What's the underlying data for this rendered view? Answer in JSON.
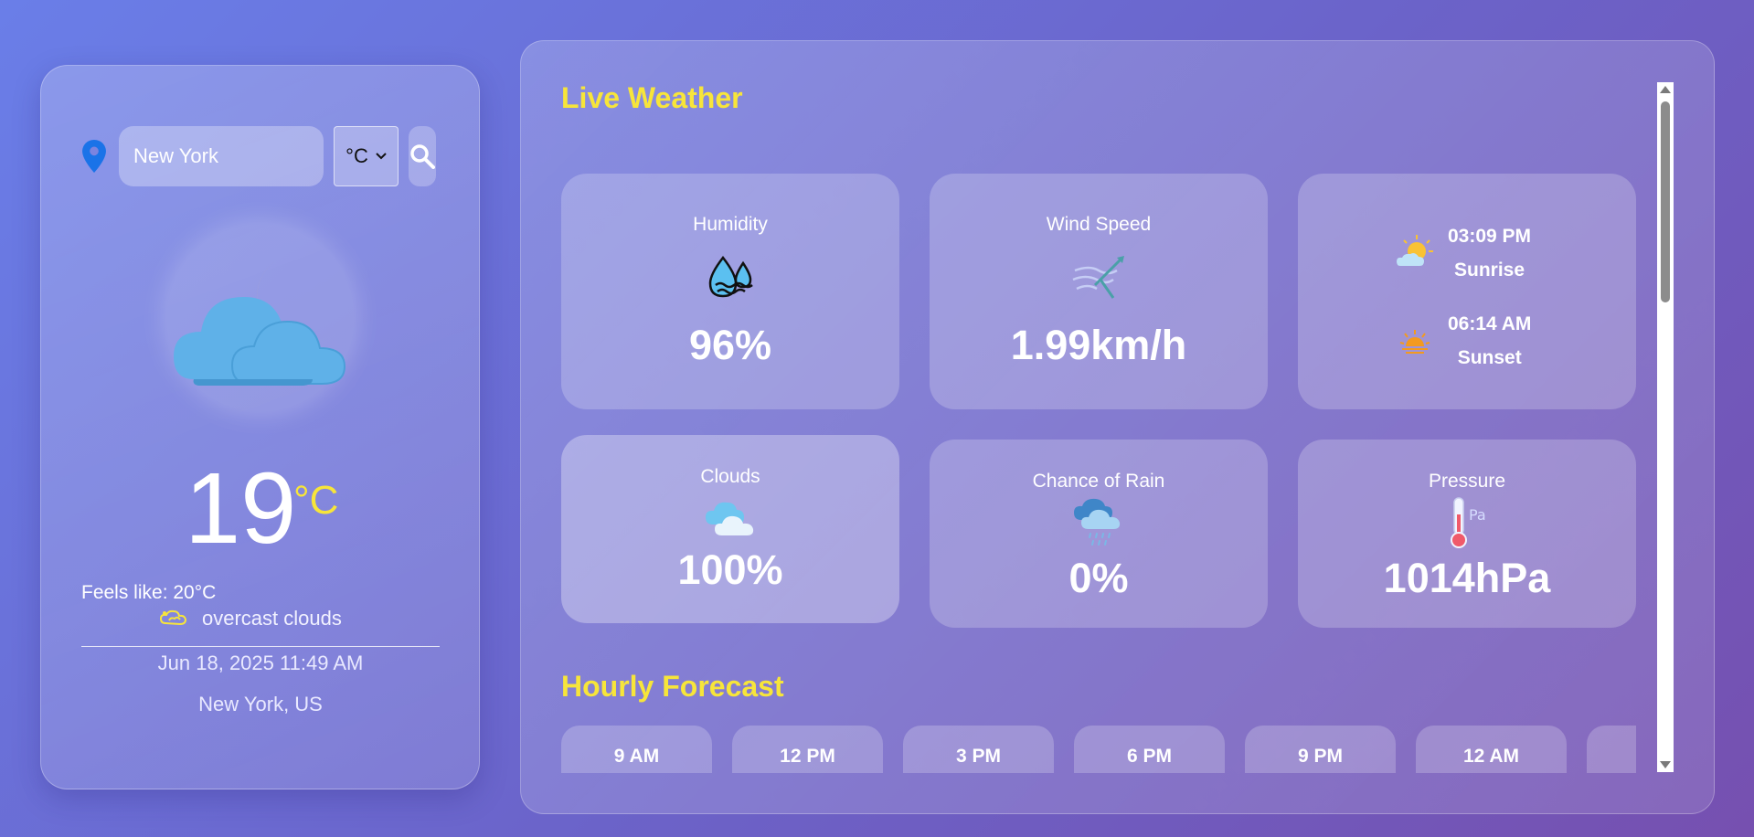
{
  "search": {
    "city_value": "New York",
    "unit_selected": "°C",
    "pin_icon": "map-pin-icon",
    "search_icon": "search-icon"
  },
  "current": {
    "icon": "moon-cloud-icon",
    "temperature": "19",
    "unit": "°C",
    "feels_like": "Feels like: 20°C",
    "description": "overcast clouds",
    "datetime": "Jun 18, 2025 11:49 AM",
    "location": "New York, US"
  },
  "live": {
    "title": "Live Weather",
    "humidity": {
      "label": "Humidity",
      "value": "96%",
      "icon": "humidity-drops-icon"
    },
    "wind": {
      "label": "Wind Speed",
      "value": "1.99km/h",
      "icon": "wind-icon"
    },
    "sun": {
      "sunrise_time": "03:09 PM",
      "sunrise_label": "Sunrise",
      "sunrise_icon": "sunrise-icon",
      "sunset_time": "06:14 AM",
      "sunset_label": "Sunset",
      "sunset_icon": "sunset-icon"
    },
    "clouds": {
      "label": "Clouds",
      "value": "100%",
      "icon": "clouds-icon"
    },
    "rain": {
      "label": "Chance of Rain",
      "value": "0%",
      "icon": "rain-cloud-icon"
    },
    "pressure": {
      "label": "Pressure",
      "value": "1014hPa",
      "icon": "thermometer-pa-icon"
    }
  },
  "hourly": {
    "title": "Hourly Forecast",
    "hours": [
      "9 AM",
      "12 PM",
      "3 PM",
      "6 PM",
      "9 PM",
      "12 AM",
      ""
    ]
  },
  "colors": {
    "accent_yellow": "#f7e53a",
    "pin_blue": "#1a73e8"
  }
}
